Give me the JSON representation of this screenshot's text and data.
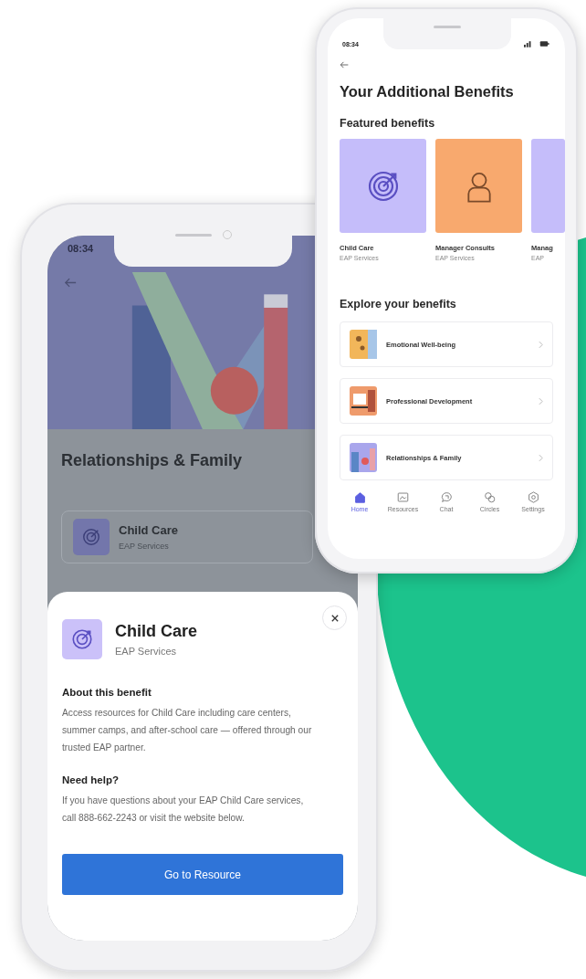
{
  "back_phone": {
    "status_time": "08:34",
    "title": "Your Additional Benefits",
    "featured_heading": "Featured benefits",
    "featured": [
      {
        "title": "Child Care",
        "subtitle": "EAP Services",
        "color": "#c5bdfa",
        "kind": "target"
      },
      {
        "title": "Manager Consults",
        "subtitle": "EAP Services",
        "color": "#f8a96e",
        "kind": "person"
      },
      {
        "title": "Manag",
        "subtitle": "EAP",
        "color": "#c5bdfa",
        "kind": "none"
      }
    ],
    "explore_heading": "Explore your benefits",
    "explore": [
      {
        "label": "Emotional Well-being",
        "kind": "wellbeing"
      },
      {
        "label": "Professional Development",
        "kind": "development"
      },
      {
        "label": "Relationships & Family",
        "kind": "relationships"
      }
    ],
    "nav": [
      {
        "label": "Home",
        "kind": "home",
        "selected": true
      },
      {
        "label": "Resources",
        "kind": "resources",
        "selected": false
      },
      {
        "label": "Chat",
        "kind": "chat",
        "selected": false
      },
      {
        "label": "Circles",
        "kind": "circles",
        "selected": false
      },
      {
        "label": "Settings",
        "kind": "settings",
        "selected": false
      }
    ]
  },
  "front_phone": {
    "status_time": "08:34",
    "page_title": "Relationships & Family",
    "card": {
      "title": "Child Care",
      "subtitle": "EAP Services"
    },
    "sheet": {
      "title": "Child Care",
      "subtitle": "EAP Services",
      "sections": [
        {
          "heading": "About this benefit",
          "body": "Access resources for Child Care including care centers, summer camps, and after-school care — offered through our trusted EAP partner."
        },
        {
          "heading": "Need help?",
          "body": "If you have questions about your EAP Child Care services, call 888-662-2243 or visit the website below."
        }
      ],
      "button": "Go to Resource"
    }
  }
}
